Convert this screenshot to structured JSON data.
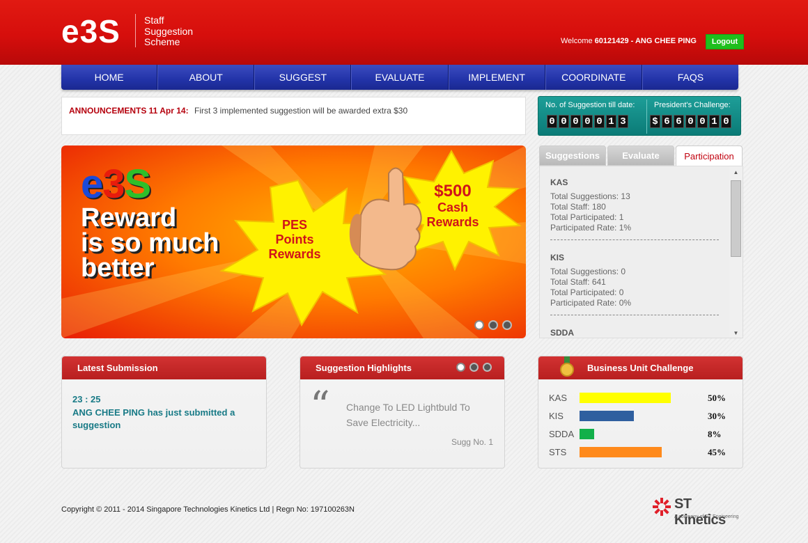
{
  "header": {
    "logo": "e3S",
    "tagline_line1": "Staff",
    "tagline_line2": "Suggestion",
    "tagline_line3": "Scheme",
    "welcome_prefix": "Welcome",
    "user": "60121429 - ANG CHEE PING",
    "logout_label": "Logout"
  },
  "nav": [
    "HOME",
    "ABOUT",
    "SUGGEST",
    "EVALUATE",
    "IMPLEMENT",
    "COORDINATE",
    "FAQS"
  ],
  "announcement": {
    "label": "ANNOUNCEMENTS 11 Apr 14:",
    "text": "First 3 implemented suggestion will be awarded extra $30"
  },
  "counter": {
    "suggestions_label": "No. of Suggestion till date:",
    "suggestions_digits": [
      "0",
      "0",
      "0",
      "0",
      "0",
      "1",
      "3"
    ],
    "challenge_label": "President's Challenge:",
    "challenge_digits": [
      "$",
      "6",
      "6",
      "0",
      "0",
      "1",
      "0"
    ]
  },
  "banner": {
    "e3s_letters": [
      "e",
      "3",
      "S"
    ],
    "e3s_colors": [
      "#1c4ad8",
      "#e81c0c",
      "#2fbf2a"
    ],
    "headline_line1": "Reward",
    "headline_line2": "is so much",
    "headline_line3": "better",
    "burst1_line1": "PES",
    "burst1_line2": "Points",
    "burst1_line3": "Rewards",
    "burst2_line1": "$500",
    "burst2_line2": "Cash",
    "burst2_line3": "Rewards",
    "slide_count": 3,
    "active_slide": 1
  },
  "tabs": [
    {
      "label": "Suggestions",
      "active": false
    },
    {
      "label": "Evaluate",
      "active": false
    },
    {
      "label": "Participation",
      "active": true
    }
  ],
  "participation": [
    {
      "name": "KAS",
      "total_suggestions": "Total Suggestions: 13",
      "total_staff": "Total Staff: 180",
      "total_participated": "Total Participated: 1",
      "participated_rate": "Participated Rate: 1%"
    },
    {
      "name": "KIS",
      "total_suggestions": "Total Suggestions: 0",
      "total_staff": "Total Staff: 641",
      "total_participated": "Total Participated: 0",
      "participated_rate": "Participated Rate: 0%"
    },
    {
      "name": "SDDA"
    }
  ],
  "latest_submission": {
    "title": "Latest Submission",
    "time": "23 : 25",
    "text": "ANG CHEE PING has just submitted a suggestion"
  },
  "highlights": {
    "title": "Suggestion Highlights",
    "quote_mark": "“",
    "text": "Change To LED Lightbuld To Save Electricity...",
    "sugg_no": "Sugg No. 1",
    "slide_count": 3,
    "active_slide": 1
  },
  "business_unit": {
    "title": "Business Unit Challenge",
    "rows": [
      {
        "name": "KAS",
        "value": 50,
        "label": "50%",
        "color": "#ffff00"
      },
      {
        "name": "KIS",
        "value": 30,
        "label": "30%",
        "color": "#2f5f9f"
      },
      {
        "name": "SDDA",
        "value": 8,
        "label": "8%",
        "color": "#12b04a"
      },
      {
        "name": "STS",
        "value": 45,
        "label": "45%",
        "color": "#ff8a1c"
      }
    ]
  },
  "footer": {
    "copyright": "Copyright © 2011 - 2014 Singapore Technologies Kinetics Ltd | Regn No: 197100263N",
    "brand": "ST Kinetics",
    "brand_sub": "A company of ST Engineering"
  }
}
